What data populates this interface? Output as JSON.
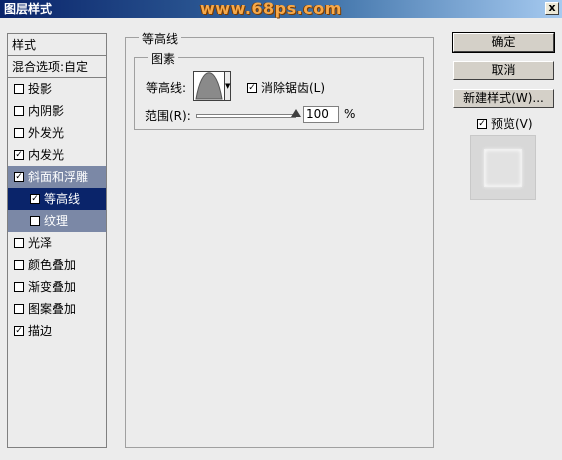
{
  "window": {
    "title": "图层样式",
    "watermark": "www.68ps.com",
    "close_label": "x"
  },
  "left": {
    "header": "样式",
    "blend_options": "混合选项:自定",
    "items": [
      {
        "label": "投影",
        "checked": false
      },
      {
        "label": "内阴影",
        "checked": false
      },
      {
        "label": "外发光",
        "checked": false
      },
      {
        "label": "内发光",
        "checked": true
      },
      {
        "label": "斜面和浮雕",
        "checked": true
      },
      {
        "label": "等高线",
        "checked": true
      },
      {
        "label": "纹理",
        "checked": false
      },
      {
        "label": "光泽",
        "checked": false
      },
      {
        "label": "颜色叠加",
        "checked": false
      },
      {
        "label": "渐变叠加",
        "checked": false
      },
      {
        "label": "图案叠加",
        "checked": false
      },
      {
        "label": "描边",
        "checked": true
      }
    ]
  },
  "panel": {
    "group_title": "等高线",
    "subgroup_title": "图素",
    "contour_label": "等高线:",
    "antialias_label": "消除锯齿(L)",
    "antialias_checked": true,
    "range_label": "范围(R):",
    "range_value": "100",
    "range_unit": "%",
    "range_fraction": 1.0
  },
  "buttons": {
    "ok": "确定",
    "cancel": "取消",
    "new_style": "新建样式(W)...",
    "preview_label": "预览(V)",
    "preview_checked": true
  },
  "colors": {
    "title_bar": "#0a246a",
    "selected_item": "#7b88a6",
    "active_item": "#0a246a"
  }
}
